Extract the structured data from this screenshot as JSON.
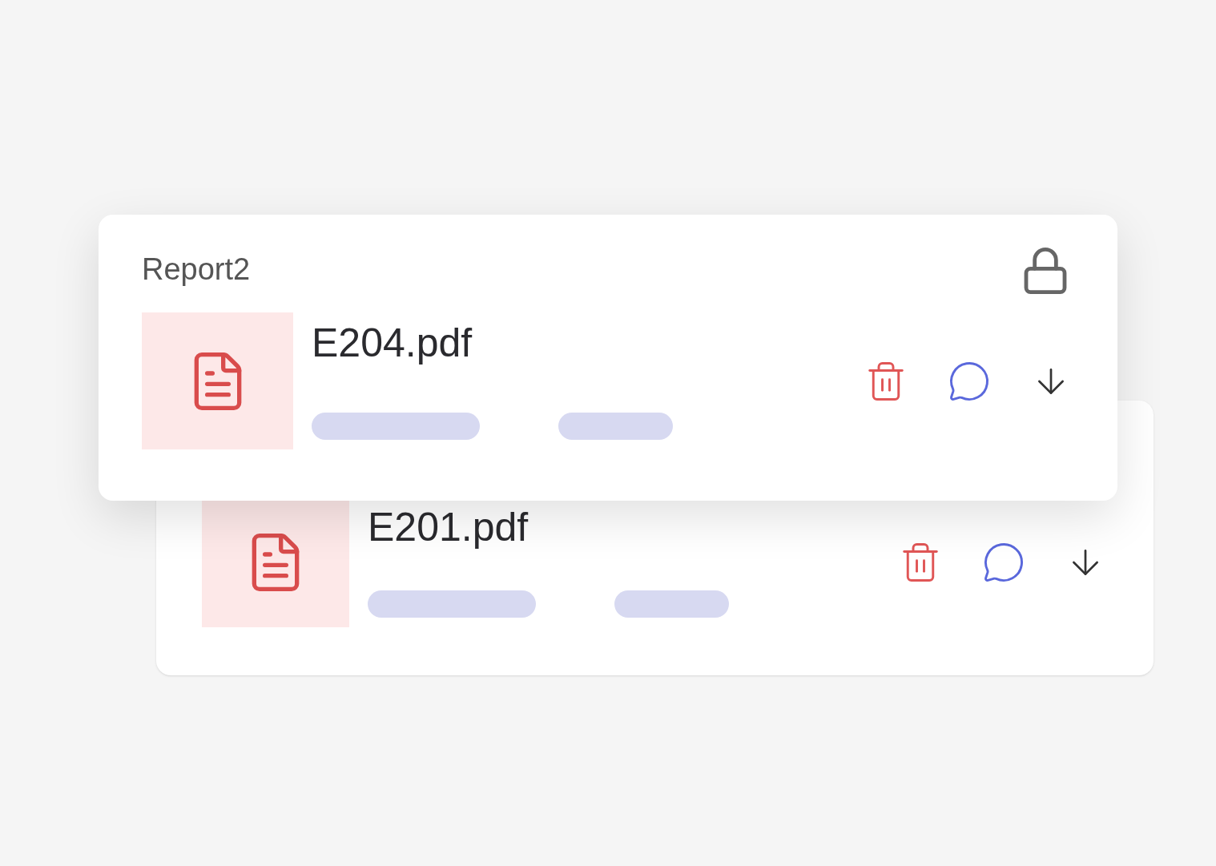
{
  "cards": [
    {
      "title": "Report2",
      "file": "E204.pdf"
    },
    {
      "file": "E201.pdf"
    }
  ]
}
